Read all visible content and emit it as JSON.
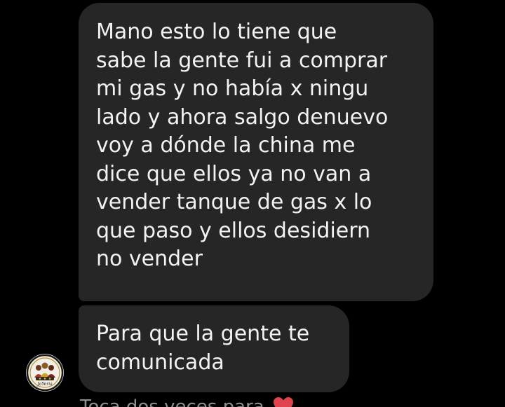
{
  "messages": [
    {
      "text": "Mano esto lo tiene que\nsabe la gente fui a comprar\nmi gas y no había x ningu\nlado y ahora salgo denuevo\nvoy a dónde la china me\ndice que ellos ya no van a\nvender tanque de gas x lo\nque paso y ellos desidiern\nno vender"
    },
    {
      "text": "Para que la gente te\ncomunicada"
    }
  ],
  "avatar": {
    "caption": "JoYeria",
    "icon": "profile-avatar-icon"
  },
  "footer": {
    "text": "Toca dos veces para",
    "icon": "heart-icon",
    "heart_color": "#e0434d"
  },
  "colors": {
    "background": "#000000",
    "bubble": "#262626",
    "text": "#f2f2f2",
    "muted": "#8e8e8e"
  }
}
